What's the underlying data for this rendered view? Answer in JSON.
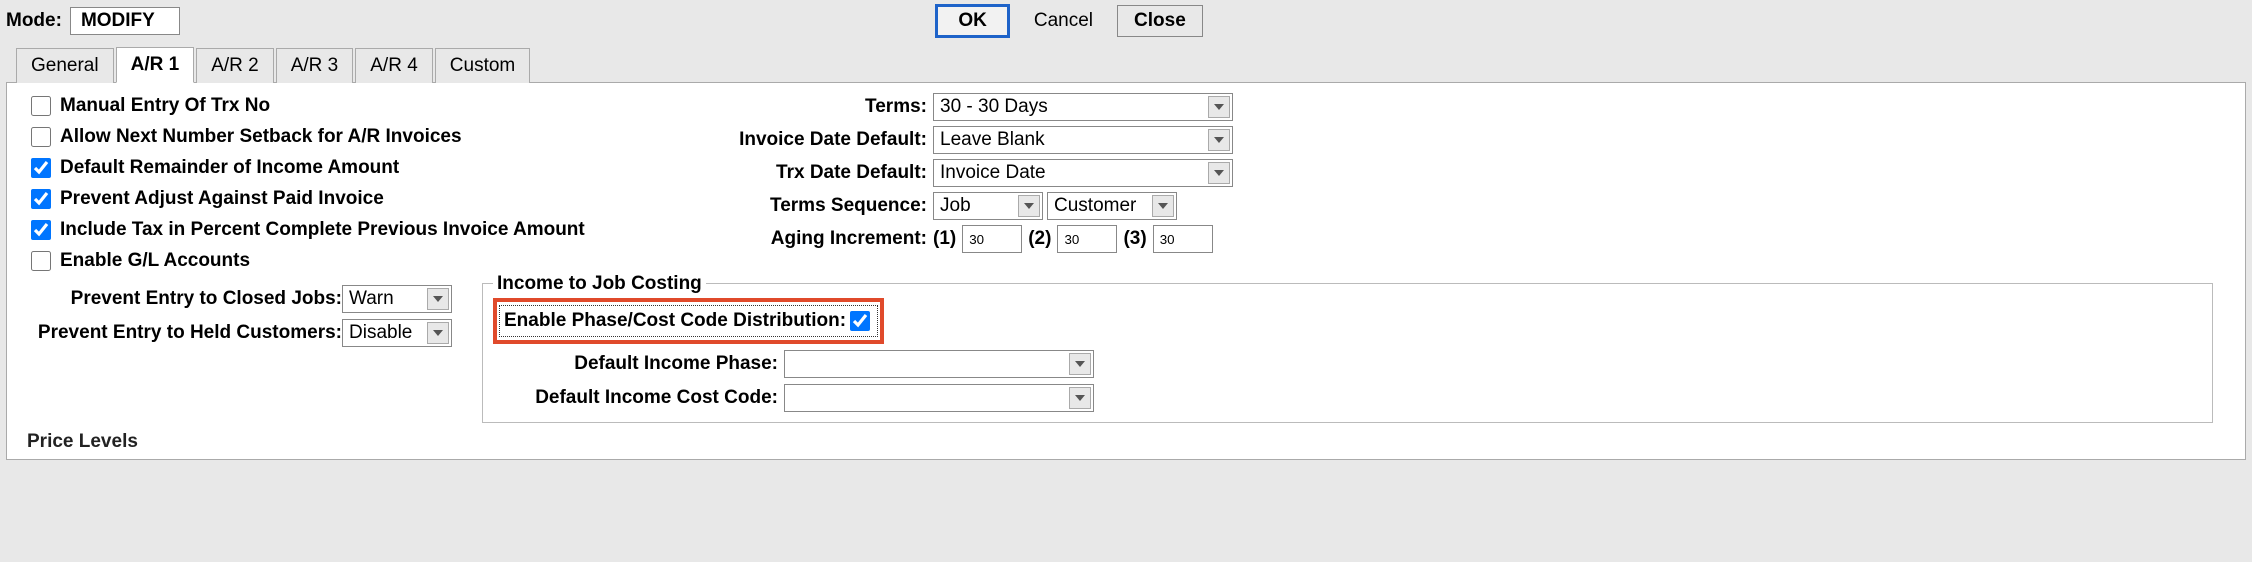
{
  "header": {
    "mode_label": "Mode:",
    "mode_value": "MODIFY",
    "ok": "OK",
    "cancel": "Cancel",
    "close": "Close"
  },
  "tabs": {
    "general": "General",
    "ar1": "A/R 1",
    "ar2": "A/R 2",
    "ar3": "A/R 3",
    "ar4": "A/R 4",
    "custom": "Custom"
  },
  "left": {
    "manual_entry": "Manual Entry Of Trx No",
    "allow_next_number": "Allow Next Number Setback for A/R Invoices",
    "default_remainder": "Default Remainder of Income Amount",
    "prevent_adjust": "Prevent Adjust Against Paid Invoice",
    "include_tax": "Include Tax in Percent Complete Previous Invoice Amount",
    "enable_gl": "Enable G/L Accounts",
    "prevent_closed_jobs_label": "Prevent Entry to Closed Jobs:",
    "prevent_closed_jobs_value": "Warn",
    "prevent_held_customers_label": "Prevent Entry to Held Customers:",
    "prevent_held_customers_value": "Disable"
  },
  "right": {
    "terms_label": "Terms:",
    "terms_value": "30  - 30 Days",
    "invoice_date_label": "Invoice Date Default:",
    "invoice_date_value": "Leave Blank",
    "trx_date_label": "Trx Date Default:",
    "trx_date_value": "Invoice Date",
    "terms_seq_label": "Terms Sequence:",
    "terms_seq_1": "Job",
    "terms_seq_2": "Customer",
    "aging_label": "Aging Increment:",
    "aging_1_label": "(1)",
    "aging_1_value": "30",
    "aging_2_label": "(2)",
    "aging_2_value": "30",
    "aging_3_label": "(3)",
    "aging_3_value": "30"
  },
  "income": {
    "legend": "Income to Job Costing",
    "enable_label": "Enable Phase/Cost Code Distribution:",
    "default_phase_label": "Default Income Phase:",
    "default_phase_value": "",
    "default_cost_label": "Default Income Cost Code:",
    "default_cost_value": ""
  },
  "footer": {
    "price_levels": "Price Levels"
  }
}
